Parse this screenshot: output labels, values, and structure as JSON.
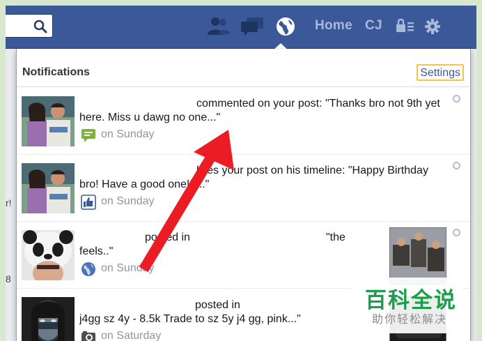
{
  "topbar": {
    "search": {
      "value": "",
      "placeholder": ""
    },
    "home_label": "Home",
    "user_initials": "CJ",
    "icons": [
      "friends-icon",
      "messages-icon",
      "globe-notifications-icon",
      "privacy-lock-icon",
      "settings-gear-icon"
    ],
    "colors": {
      "bar": "#3b5998",
      "icon_inactive": "#a9b9d8",
      "icon_active": "#ffffff"
    }
  },
  "left_column": {
    "stub_texts": [
      "r!",
      "8"
    ]
  },
  "notifications": {
    "title": "Notifications",
    "settings_label": "Settings",
    "items": [
      {
        "line1": "commented on your post: \"Thanks bro not 9th yet",
        "line2": "here. Miss u dawg no one...\"",
        "time": "on Sunday",
        "type_icon": "comment-icon",
        "has_thumbnail": false
      },
      {
        "line1": "likes your post on his timeline: \"Happy Birthday",
        "line2": "bro! Have a good one!!!...\"",
        "time": "on Sunday",
        "type_icon": "like-icon",
        "has_thumbnail": false
      },
      {
        "line1a": "posted in",
        "line1b": "\"the",
        "line2": "feels..\"",
        "time": "on Sunday",
        "type_icon": "globe-icon",
        "has_thumbnail": true
      },
      {
        "line1": "posted in",
        "line2": "j4gg sz 4y - 8.5k Trade to sz 5y j4 gg, pink...\"",
        "time": "on Saturday",
        "type_icon": "camera-icon",
        "has_thumbnail": true
      }
    ]
  },
  "watermark": {
    "title": "百科全说",
    "subtitle": "助你轻松解决"
  },
  "annotation": {
    "arrow_color": "#ec1c24"
  }
}
